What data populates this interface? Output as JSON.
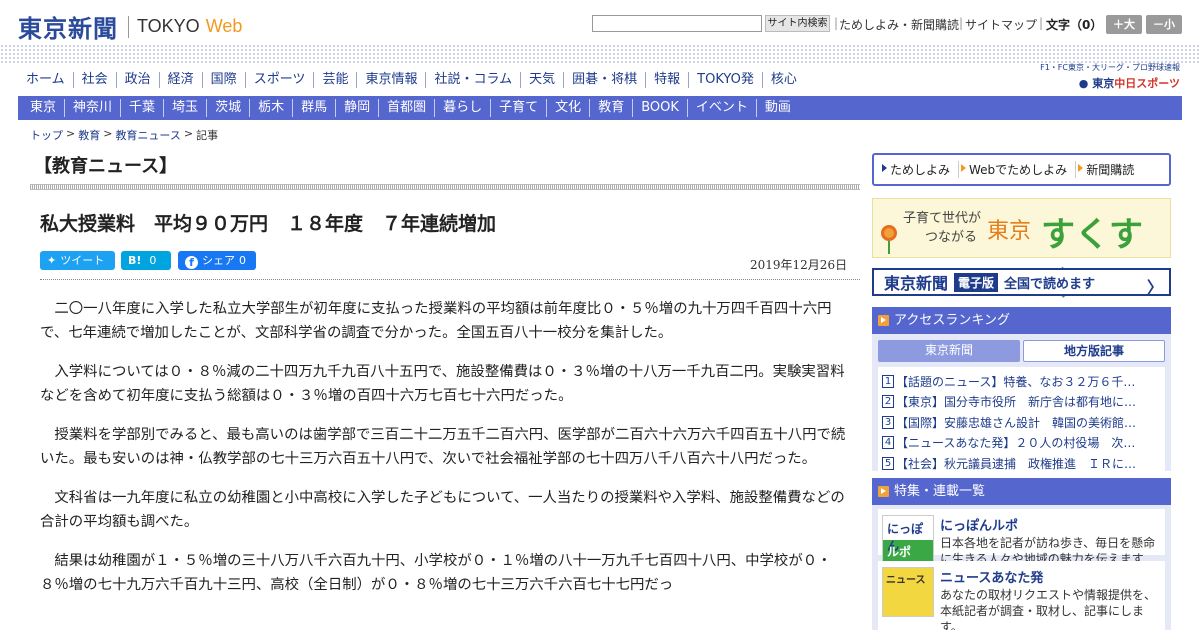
{
  "header": {
    "logo_jp": "東京新聞",
    "logo_en": "TOKYO",
    "logo_web": "Web",
    "search_placeholder": "",
    "search_button": "サイト内検索",
    "links": [
      "ためしよみ・新聞購読",
      "サイトマップ"
    ],
    "font_size_label": "文字（0）",
    "font_larger": "＋大",
    "font_smaller": "－小"
  },
  "promo": {
    "small": "F1・FC東京・大リーグ・プロ野球速報",
    "name_prefix": "● 東京",
    "name_brand": "中日スポーツ"
  },
  "nav_primary": [
    "ホーム",
    "社会",
    "政治",
    "経済",
    "国際",
    "スポーツ",
    "芸能",
    "東京情報",
    "社説・コラム",
    "天気",
    "囲碁・将棋",
    "特報",
    "TOKYO発",
    "核心"
  ],
  "nav_secondary": [
    "東京",
    "神奈川",
    "千葉",
    "埼玉",
    "茨城",
    "栃木",
    "群馬",
    "静岡",
    "首都圏",
    "暮らし",
    "子育て",
    "文化",
    "教育",
    "BOOK",
    "イベント",
    "動画"
  ],
  "breadcrumb": {
    "items": [
      "トップ",
      "教育",
      "教育ニュース",
      "記事"
    ],
    "separator": ">"
  },
  "section_title": "【教育ニュース】",
  "article": {
    "title": "私大授業料　平均９０万円　１８年度　７年連続増加",
    "date": "2019年12月26日",
    "share": {
      "tweet_label": "ツイート",
      "hatena_icon": "B!",
      "hatena_count": "0",
      "facebook_label": "シェア",
      "facebook_count": "0"
    },
    "paragraphs": [
      "二〇一八年度に入学した私立大学部生が初年度に支払った授業料の平均額は前年度比０・５％増の九十万四千百四十六円で、七年連続で増加したことが、文部科学省の調査で分かった。全国五百八十一校分を集計した。",
      "入学料については０・８％減の二十四万九千九百八十五円で、施設整備費は０・３％増の十八万一千九百二円。実験実習料などを含めて初年度に支払う総額は０・３％増の百四十六万七百七十六円だった。",
      "授業料を学部別でみると、最も高いのは歯学部で三百二十二万五千二百六円、医学部が二百六十六万六千四百五十八円で続いた。最も安いのは神・仏教学部の七十三万六百五十八円で、次いで社会福祉学部の七十四万八千八百六十八円だった。",
      "文科省は一九年度に私立の幼稚園と小中高校に入学した子どもについて、一人当たりの授業料や入学料、施設整備費などの合計の平均額も調べた。",
      "結果は幼稚園が１・５％増の三十八万八千六百九十円、小学校が０・１％増の八十一万九千七百四十八円、中学校が０・８％増の七十九万六千百九十三円、高校（全日制）が０・８％増の七十三万六千六百七十七円だっ"
    ]
  },
  "sidebar": {
    "quick_links": [
      "ためしよみ",
      "Webでためしよみ",
      "新聞購読"
    ],
    "sukusuku": {
      "tag_line1": "子育て世代が",
      "tag_line2": "つながる",
      "brand_a": "東京",
      "brand_b": "すくすく"
    },
    "epaper": {
      "logo": "東京新聞",
      "badge": "電子版",
      "text": "全国で読めます"
    },
    "ranking": {
      "heading": "アクセスランキング",
      "tabs": [
        "東京新聞",
        "地方版記事"
      ],
      "items": [
        {
          "rank": "1",
          "text": "【話題のニュース】特養、なお３２万６千…"
        },
        {
          "rank": "2",
          "text": "【東京】国分寺市役所　新庁舎は都有地に…"
        },
        {
          "rank": "3",
          "text": "【国際】安藤忠雄さん設計　韓国の美術館…"
        },
        {
          "rank": "4",
          "text": "【ニュースあなた発】２０人の村役場　次…"
        },
        {
          "rank": "5",
          "text": "【社会】秋元議員逮捕　政権推進　ＩＲに…"
        }
      ]
    },
    "features": {
      "heading": "特集・連載一覧",
      "items": [
        {
          "img_line1": "にっぽん",
          "img_line2": "ルポ",
          "title": "にっぽんルポ",
          "desc": "日本各地を記者が訪ね歩き、毎日を懸命に生きる人々や地域の魅力を伝えます"
        },
        {
          "img_line1": "ニュース",
          "title": "ニュースあなた発",
          "desc": "あなたの取材リクエストや情報提供を、本紙記者が調査・取材し、記事にします。"
        }
      ]
    }
  }
}
